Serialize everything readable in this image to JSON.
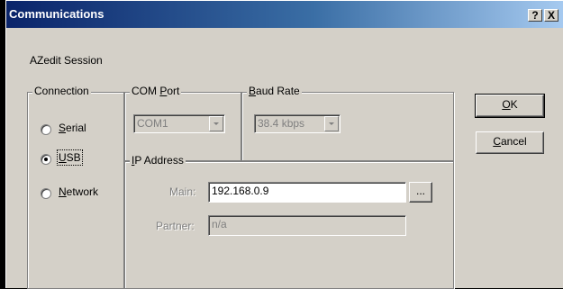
{
  "window": {
    "title": "Communications",
    "help_button": "?",
    "close_button": "X"
  },
  "session_label": "AZedit Session",
  "connection": {
    "legend": "Connection",
    "options": [
      {
        "prefix": "",
        "mnemonic": "S",
        "rest": "erial",
        "selected": false
      },
      {
        "prefix": "",
        "mnemonic": "U",
        "rest": "SB",
        "selected": true
      },
      {
        "prefix": "",
        "mnemonic": "N",
        "rest": "etwork",
        "selected": false
      }
    ]
  },
  "com_port": {
    "legend_prefix": "COM ",
    "legend_mnemonic": "P",
    "legend_rest": "ort",
    "value": "COM1"
  },
  "baud_rate": {
    "legend_mnemonic": "B",
    "legend_rest": "aud Rate",
    "value": "38.4 kbps"
  },
  "ip_address": {
    "legend_mnemonic": "I",
    "legend_rest": "P Address",
    "main_label": "Main:",
    "main_value": "192.168.0.9",
    "browse_label": "...",
    "partner_label": "Partner:",
    "partner_value": "n/a"
  },
  "buttons": {
    "ok_mnemonic": "O",
    "ok_rest": "K",
    "cancel_mnemonic": "C",
    "cancel_rest": "ancel"
  }
}
